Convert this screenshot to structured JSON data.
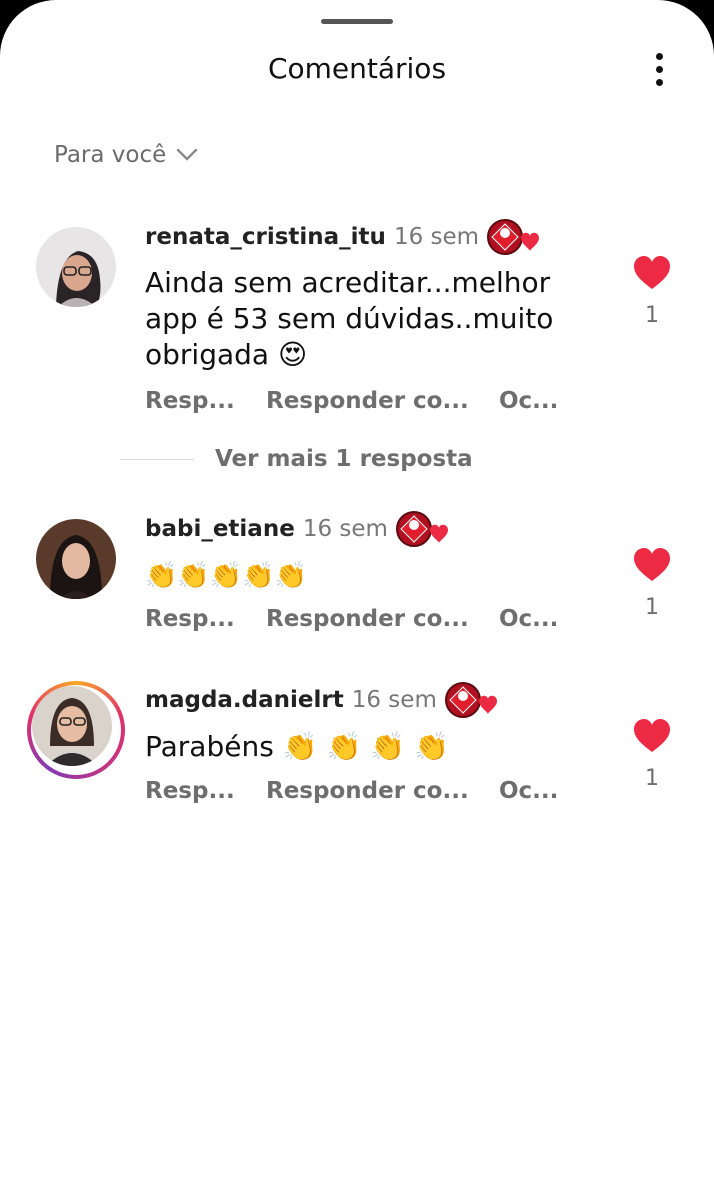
{
  "header": {
    "title": "Comentários"
  },
  "filter": {
    "label": "Para você"
  },
  "actions": {
    "reply": "Resp...",
    "reply_with": "Responder co...",
    "hide": "Oc..."
  },
  "comments": [
    {
      "username": "renata_cristina_itu",
      "time": "16 sem",
      "text": "Ainda sem acreditar...melhor app é 53 sem dúvidas..muito obrigada 😍",
      "likes": "1",
      "more_replies": "Ver mais 1 resposta"
    },
    {
      "username": "babi_etiane",
      "time": "16 sem",
      "text": "👏👏👏👏👏",
      "likes": "1"
    },
    {
      "username": "magda.danielrt",
      "time": "16 sem",
      "text": "Parabéns 👏 👏 👏 👏",
      "likes": "1"
    }
  ],
  "colors": {
    "like": "#ed2a44",
    "badge": "#c2121f",
    "text": "#111111",
    "muted": "#6e6e6e"
  }
}
